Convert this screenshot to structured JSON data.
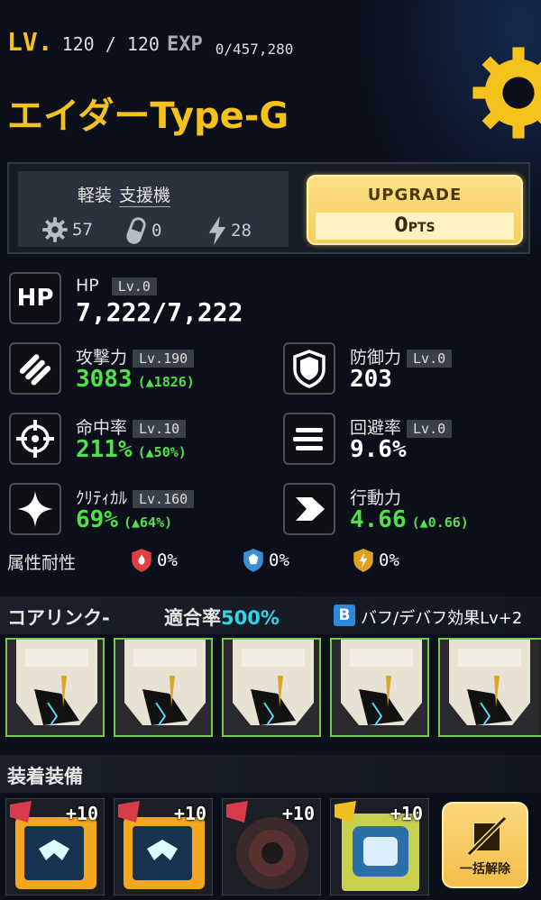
{
  "header": {
    "lv_label": "LV.",
    "level": "120 / 120",
    "exp_label": "EXP",
    "exp_value": "0/457,280",
    "unit_name": "エイダーType-G"
  },
  "info": {
    "class_weight": "軽装",
    "class_role": "支援機",
    "gear_count": "57",
    "capsule_count": "0",
    "bolt_count": "28",
    "upgrade_label": "UPGRADE",
    "upgrade_pts_value": "0",
    "upgrade_pts_unit": "PTS"
  },
  "stats": {
    "hp": {
      "icon_text": "HP",
      "name": "HP",
      "lv": "Lv.0",
      "value": "7,222/7,222"
    },
    "attack": {
      "name": "攻撃力",
      "lv": "Lv.190",
      "value": "3083",
      "bonus": "(▲1826)"
    },
    "defense": {
      "name": "防御力",
      "lv": "Lv.0",
      "value": "203"
    },
    "accuracy": {
      "name": "命中率",
      "lv": "Lv.10",
      "value": "211%",
      "bonus": "(▲50%)"
    },
    "evasion": {
      "name": "回避率",
      "lv": "Lv.0",
      "value": "9.6%"
    },
    "critical": {
      "name": "ｸﾘﾃｨｶﾙ",
      "lv": "Lv.160",
      "value": "69%",
      "bonus": "(▲64%)"
    },
    "action": {
      "name": "行動力",
      "value": "4.66",
      "bonus": "(▲0.66)"
    }
  },
  "resist": {
    "label": "属性耐性",
    "fire": "0%",
    "ice": "0%",
    "thunder": "0%"
  },
  "core_link": {
    "title": "コアリンク-",
    "rate_label": "適合率",
    "rate_value": "500%",
    "buff_badge": "B",
    "buff_text": "バフ/デバフ効果Lv+2"
  },
  "equipment": {
    "title": "装着装備",
    "slots": [
      {
        "plus": "+10"
      },
      {
        "plus": "+10"
      },
      {
        "plus": "+10"
      },
      {
        "plus": "+10"
      }
    ],
    "unequip_label": "一括解除"
  },
  "colors": {
    "accent_yellow": "#f5c21b",
    "green": "#52e04a",
    "cyan": "#2fd6e8",
    "slot_border": "#78c850"
  }
}
